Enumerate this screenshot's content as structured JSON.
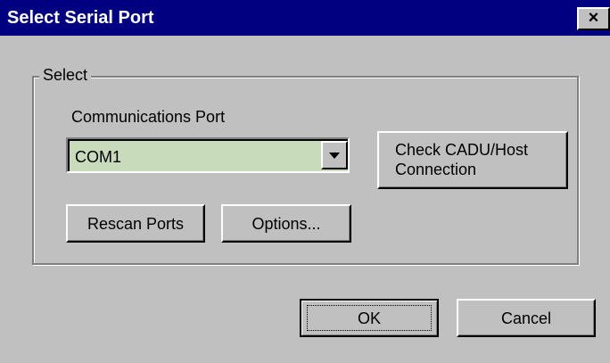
{
  "window": {
    "title": "Select Serial Port",
    "close_glyph": "×",
    "close_icon": "close-icon"
  },
  "group": {
    "legend": "Select"
  },
  "port": {
    "label": "Communications Port",
    "selected": "COM1",
    "dropdown_icon": "chevron-down-icon"
  },
  "buttons": {
    "check": "Check CADU/Host\nConnection",
    "rescan": "Rescan Ports",
    "options": "Options...",
    "ok": "OK",
    "cancel": "Cancel"
  },
  "colors": {
    "titlebar": "#000080",
    "dialog_face": "#c0c0c0",
    "combo_background": "#c8dcbc"
  }
}
